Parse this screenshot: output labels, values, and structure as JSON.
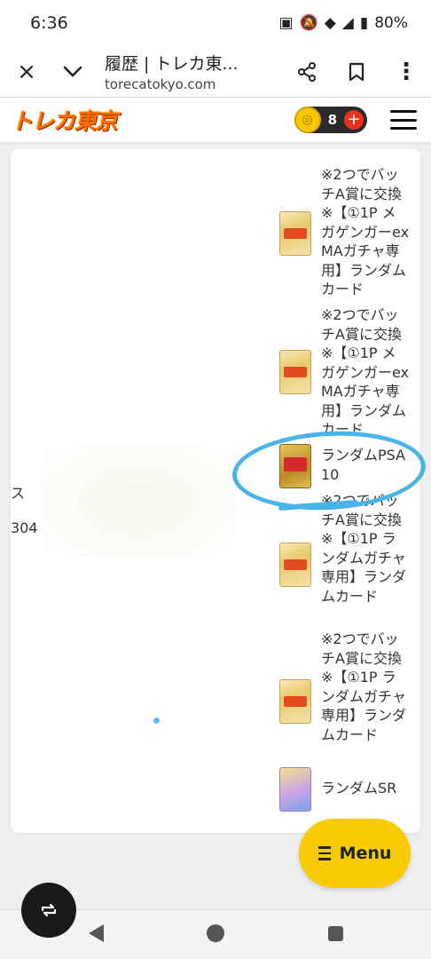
{
  "status_bar": {
    "time": "6:36",
    "battery": "80%"
  },
  "browser": {
    "close_icon": "×",
    "expand_icon": "⌄",
    "title": "履歴 | トレカ東...",
    "url": "torecatokyo.com",
    "share_icon": "share-icon",
    "bookmark_icon": "bookmark-icon",
    "more_icon": "⋮"
  },
  "header": {
    "logo_text": "トレカ東京",
    "coin_count": "8",
    "coin_plus": "+"
  },
  "left_fragments": {
    "line1": "ス",
    "line2": "304"
  },
  "prizes": [
    {
      "text": "※2つでバッチA賞に交換※【①1P メガゲンガーex MAガチャ専用】ランダムカード",
      "thumb": "random-card"
    },
    {
      "text": "※2つでバッチA賞に交換※【①1P メガゲンガーex MAガチャ専用】ランダムカード",
      "thumb": "random-card"
    },
    {
      "text": "ランダムPSA10",
      "thumb": "psa10-card"
    },
    {
      "text": "※2つでバッチA賞に交換※【①1P ランダムガチャ専用】ランダムカード",
      "thumb": "random-card"
    },
    {
      "text": "※2つでバッチA賞に交換※【①1P ランダムガチャ専用】ランダムカード",
      "thumb": "random-card"
    },
    {
      "text": "ランダムSR",
      "thumb": "sr-card"
    }
  ],
  "menu_button": {
    "label": "Menu"
  },
  "colors": {
    "accent_yellow": "#f8cb05",
    "annotation_blue": "#4ab3e8",
    "logo_orange": "#ff6a00"
  }
}
